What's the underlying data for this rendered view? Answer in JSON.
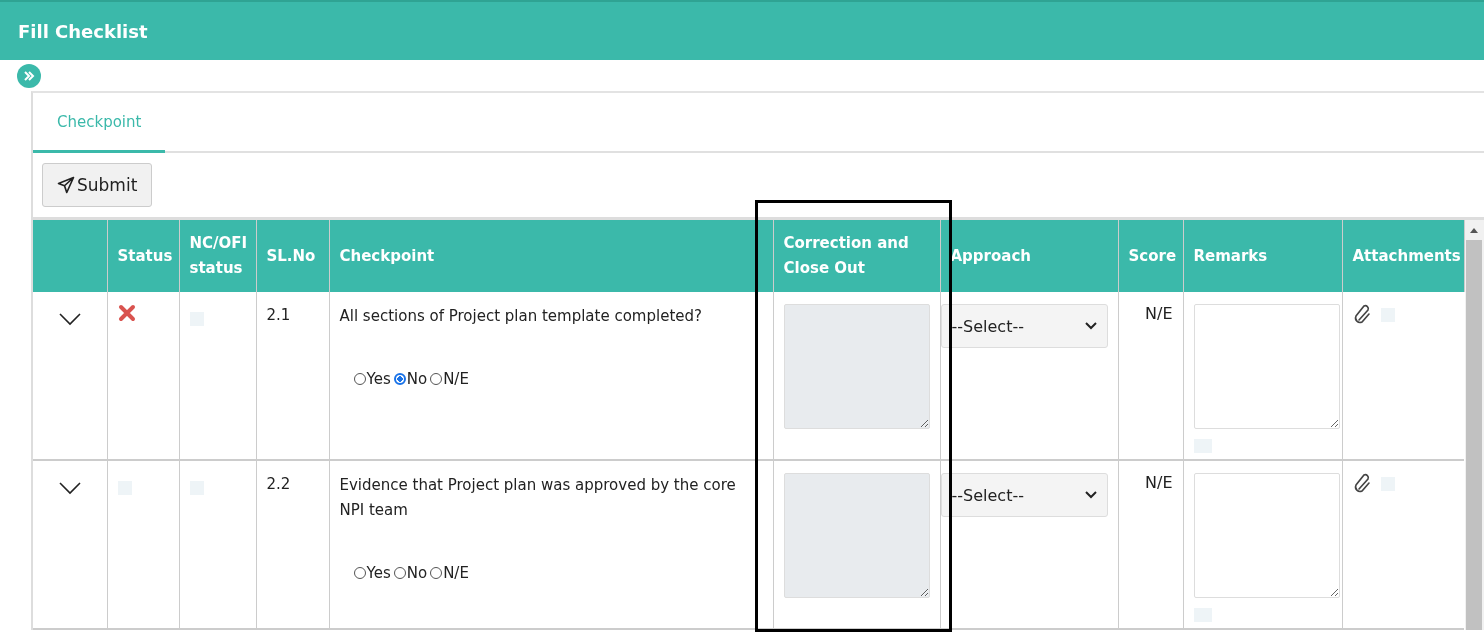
{
  "header": {
    "title": "Fill Checklist"
  },
  "tabs": [
    {
      "label": "Checkpoint",
      "selected": true
    }
  ],
  "toolbar": {
    "submit_label": "Submit"
  },
  "table": {
    "columns": [
      "Status",
      "NC/OFI status",
      "SL.No",
      "Checkpoint",
      "Correction and Close Out",
      "Approach",
      "Score",
      "Remarks",
      "Attachments"
    ],
    "rows": [
      {
        "expanded": false,
        "failed": true,
        "sl_no": "2.1",
        "checkpoint": "All sections of Project plan template completed?",
        "options": [
          {
            "label": "Yes",
            "selected": false
          },
          {
            "label": "No",
            "selected": true
          },
          {
            "label": "N/E",
            "selected": false
          }
        ],
        "approach": "--Select--",
        "score": "N/E"
      },
      {
        "expanded": false,
        "failed": false,
        "sl_no": "2.2",
        "checkpoint": "Evidence that Project plan was approved by the core NPI team",
        "options": [
          {
            "label": "Yes",
            "selected": false
          },
          {
            "label": "No",
            "selected": false
          },
          {
            "label": "N/E",
            "selected": false
          }
        ],
        "approach": "--Select--",
        "score": "N/E"
      }
    ]
  }
}
